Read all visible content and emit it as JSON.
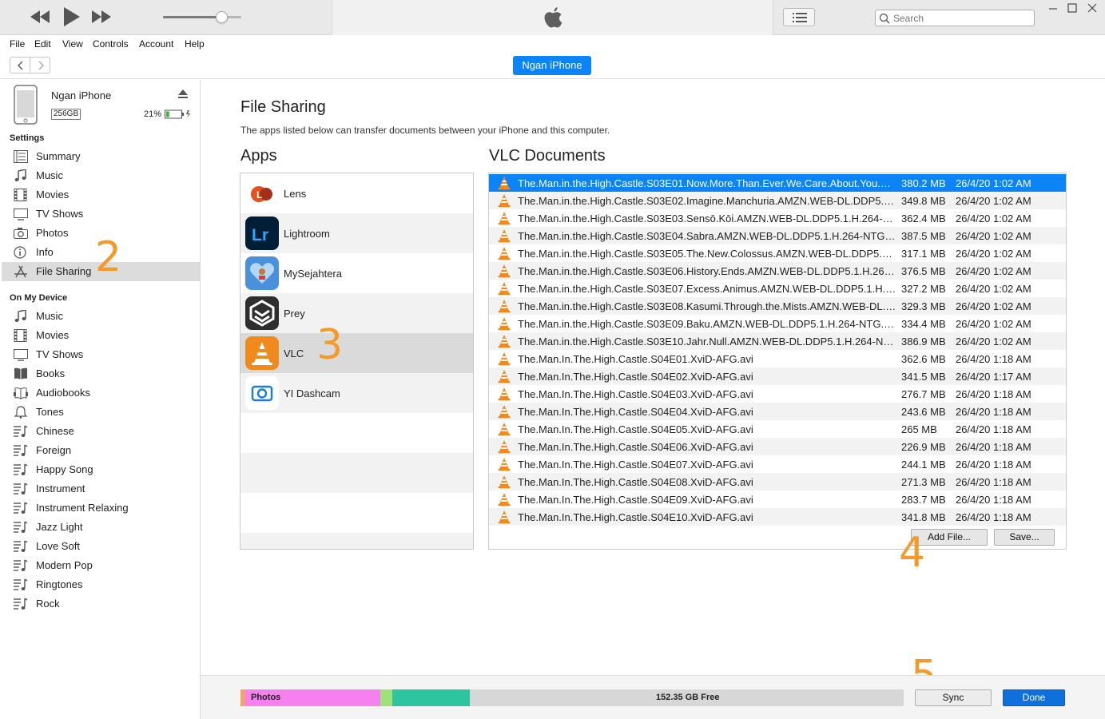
{
  "window": {
    "search_placeholder": "Search",
    "device_pill": "Ngan iPhone"
  },
  "menu": [
    "File",
    "Edit",
    "View",
    "Controls",
    "Account",
    "Help"
  ],
  "device": {
    "name": "Ngan iPhone",
    "capacity": "256GB",
    "battery": "21%",
    "battery_level": 0.21
  },
  "sidebar": {
    "settings_header": "Settings",
    "settings_items": [
      {
        "label": "Summary",
        "icon": "summary-icon"
      },
      {
        "label": "Music",
        "icon": "music-icon"
      },
      {
        "label": "Movies",
        "icon": "movies-icon"
      },
      {
        "label": "TV Shows",
        "icon": "tv-icon"
      },
      {
        "label": "Photos",
        "icon": "camera-icon"
      },
      {
        "label": "Info",
        "icon": "info-icon"
      },
      {
        "label": "File Sharing",
        "icon": "app-store-icon"
      }
    ],
    "device_header": "On My Device",
    "device_items": [
      {
        "label": "Music",
        "icon": "music-icon"
      },
      {
        "label": "Movies",
        "icon": "movies-icon"
      },
      {
        "label": "TV Shows",
        "icon": "tv-icon"
      },
      {
        "label": "Books",
        "icon": "book-icon"
      },
      {
        "label": "Audiobooks",
        "icon": "audiobook-icon"
      },
      {
        "label": "Tones",
        "icon": "bell-icon"
      },
      {
        "label": "Chinese",
        "icon": "playlist-icon"
      },
      {
        "label": "Foreign",
        "icon": "playlist-icon"
      },
      {
        "label": "Happy Song",
        "icon": "playlist-icon"
      },
      {
        "label": "Instrument",
        "icon": "playlist-icon"
      },
      {
        "label": "Instrument Relaxing",
        "icon": "playlist-icon"
      },
      {
        "label": "Jazz Light",
        "icon": "playlist-icon"
      },
      {
        "label": "Love Soft",
        "icon": "playlist-icon"
      },
      {
        "label": "Modern Pop",
        "icon": "playlist-icon"
      },
      {
        "label": "Ringtones",
        "icon": "playlist-icon"
      },
      {
        "label": "Rock",
        "icon": "playlist-icon"
      }
    ]
  },
  "main": {
    "title": "File Sharing",
    "description": "The apps listed below can transfer documents between your iPhone and this computer.",
    "apps_title": "Apps",
    "docs_title": "VLC Documents",
    "apps": [
      {
        "name": "Lens",
        "icon": "lens-icon"
      },
      {
        "name": "Lightroom",
        "icon": "lightroom-icon"
      },
      {
        "name": "MySejahtera",
        "icon": "mysejahtera-icon"
      },
      {
        "name": "Prey",
        "icon": "prey-icon"
      },
      {
        "name": "VLC",
        "icon": "vlc-icon"
      },
      {
        "name": "YI Dashcam",
        "icon": "yi-dashcam-icon"
      }
    ],
    "documents": [
      {
        "name": "The.Man.in.the.High.Castle.S03E01.Now.More.Than.Ever.We.Care.About.You.HA...",
        "size": "380.2 MB",
        "date": "26/4/20 1:02 AM"
      },
      {
        "name": "The.Man.in.the.High.Castle.S03E02.Imagine.Manchuria.AMZN.WEB-DL.DDP5.1....",
        "size": "349.8 MB",
        "date": "26/4/20 1:02 AM"
      },
      {
        "name": "The.Man.in.the.High.Castle.S03E03.Sensō.Kōi.AMZN.WEB-DL.DDP5.1.H.264-NT...",
        "size": "362.4 MB",
        "date": "26/4/20 1:02 AM"
      },
      {
        "name": "The.Man.in.the.High.Castle.S03E04.Sabra.AMZN.WEB-DL.DDP5.1.H.264-NTG.mkv",
        "size": "387.5 MB",
        "date": "26/4/20 1:02 AM"
      },
      {
        "name": "The.Man.in.the.High.Castle.S03E05.The.New.Colossus.AMZN.WEB-DL.DDP5.1.H....",
        "size": "317.1 MB",
        "date": "26/4/20 1:02 AM"
      },
      {
        "name": "The.Man.in.the.High.Castle.S03E06.History.Ends.AMZN.WEB-DL.DDP5.1.H.264-...",
        "size": "376.5 MB",
        "date": "26/4/20 1:02 AM"
      },
      {
        "name": "The.Man.in.the.High.Castle.S03E07.Excess.Animus.AMZN.WEB-DL.DDP5.1.H.26...",
        "size": "327.2 MB",
        "date": "26/4/20 1:02 AM"
      },
      {
        "name": "The.Man.in.the.High.Castle.S03E08.Kasumi.Through.the.Mists.AMZN.WEB-DL.D...",
        "size": "329.3 MB",
        "date": "26/4/20 1:02 AM"
      },
      {
        "name": "The.Man.in.the.High.Castle.S03E09.Baku.AMZN.WEB-DL.DDP5.1.H.264-NTG.mkv",
        "size": "334.4 MB",
        "date": "26/4/20 1:02 AM"
      },
      {
        "name": "The.Man.in.the.High.Castle.S03E10.Jahr.Null.AMZN.WEB-DL.DDP5.1.H.264-NTG...",
        "size": "386.9 MB",
        "date": "26/4/20 1:02 AM"
      },
      {
        "name": "The.Man.In.The.High.Castle.S04E01.XviD-AFG.avi",
        "size": "362.6 MB",
        "date": "26/4/20 1:18 AM"
      },
      {
        "name": "The.Man.In.The.High.Castle.S04E02.XviD-AFG.avi",
        "size": "341.5 MB",
        "date": "26/4/20 1:17 AM"
      },
      {
        "name": "The.Man.In.The.High.Castle.S04E03.XviD-AFG.avi",
        "size": "276.7 MB",
        "date": "26/4/20 1:18 AM"
      },
      {
        "name": "The.Man.In.The.High.Castle.S04E04.XviD-AFG.avi",
        "size": "243.6 MB",
        "date": "26/4/20 1:18 AM"
      },
      {
        "name": "The.Man.In.The.High.Castle.S04E05.XviD-AFG.avi",
        "size": "265 MB",
        "date": "26/4/20 1:18 AM"
      },
      {
        "name": "The.Man.In.The.High.Castle.S04E06.XviD-AFG.avi",
        "size": "226.9 MB",
        "date": "26/4/20 1:18 AM"
      },
      {
        "name": "The.Man.In.The.High.Castle.S04E07.XviD-AFG.avi",
        "size": "244.1 MB",
        "date": "26/4/20 1:18 AM"
      },
      {
        "name": "The.Man.In.The.High.Castle.S04E08.XviD-AFG.avi",
        "size": "271.3 MB",
        "date": "26/4/20 1:18 AM"
      },
      {
        "name": "The.Man.In.The.High.Castle.S04E09.XviD-AFG.avi",
        "size": "283.7 MB",
        "date": "26/4/20 1:18 AM"
      },
      {
        "name": "The.Man.In.The.High.Castle.S04E10.XviD-AFG.avi",
        "size": "341.8 MB",
        "date": "26/4/20 1:18 AM"
      }
    ],
    "add_file_label": "Add File...",
    "save_label": "Save..."
  },
  "annotations": {
    "step2": "2",
    "step3": "3",
    "step4": "4",
    "step5": "5"
  },
  "storage": {
    "photos_label": "Photos",
    "free_label": "152.35 GB Free",
    "colors": {
      "other": "#f6a06a",
      "photos": "#f780f0",
      "apps": "#9fe27a",
      "docs": "#2dc4a0",
      "free": "#d7d7d7"
    }
  },
  "buttons": {
    "sync": "Sync",
    "done": "Done"
  },
  "colors": {
    "accent": "#0d84f6",
    "selection": "#dcdcdc",
    "step": "#f39a2a"
  }
}
